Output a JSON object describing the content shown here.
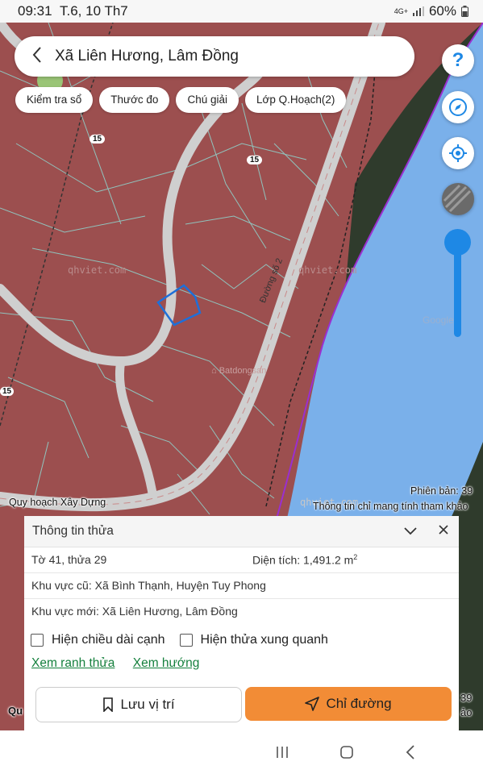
{
  "status_bar": {
    "time": "09:31",
    "date": "T.6, 10 Th7",
    "network": "4G+",
    "battery": "60%"
  },
  "search": {
    "location": "Xã Liên Hương, Lâm Đồng"
  },
  "chips": [
    "Kiểm tra sổ",
    "Thước đo",
    "Chú giải",
    "Lớp Q.Hoạch(2)"
  ],
  "side_buttons": [
    "help-icon",
    "compass-icon",
    "locate-icon",
    "layers-icon"
  ],
  "map": {
    "road_label": "Đường số 2",
    "shield_labels": [
      "15",
      "15",
      "15"
    ],
    "watermarks": [
      "qhviet.com",
      "qhviet.com",
      "qhviet.com",
      "Google"
    ],
    "bds_watermark": "Batdongsan",
    "layer_label": "Quy hoạch Xây Dựng",
    "layer_label_partial": "Qu",
    "version": "Phiên bản: 39",
    "version_partial": "39",
    "disclaimer": "Thông tin chỉ mang tính tham khảo",
    "disclaimer_partial": "ảo",
    "colors": {
      "land": "#9c4f4f",
      "parcel_lines": "#8fd0c9",
      "water": "#7ab0ea",
      "road": "#cfcfcf",
      "selected_parcel": "#1e6fd9"
    }
  },
  "panel": {
    "title": "Thông tin thửa",
    "sheet_parcel": "Tờ 41, thửa 29",
    "area_label": "Diện tích:",
    "area_value": "1,491.2 m",
    "area_unit_sup": "2",
    "old_area_label": "Khu vực cũ:",
    "old_area_value": "Xã Bình Thạnh, Huyện Tuy Phong",
    "new_area_label": "Khu vực mới:",
    "new_area_value": "Xã Liên Hương, Lâm Đồng",
    "checkbox_edge_length": "Hiện chiều dài cạnh",
    "checkbox_neighbors": "Hiện thửa xung quanh",
    "link_boundary": "Xem ranh thửa",
    "link_direction": "Xem hướng",
    "save_button": "Lưu vị trí",
    "route_button": "Chỉ đường",
    "accent_color": "#f28c36"
  },
  "nav_bar": [
    "recents-icon",
    "home-icon",
    "back-icon"
  ]
}
